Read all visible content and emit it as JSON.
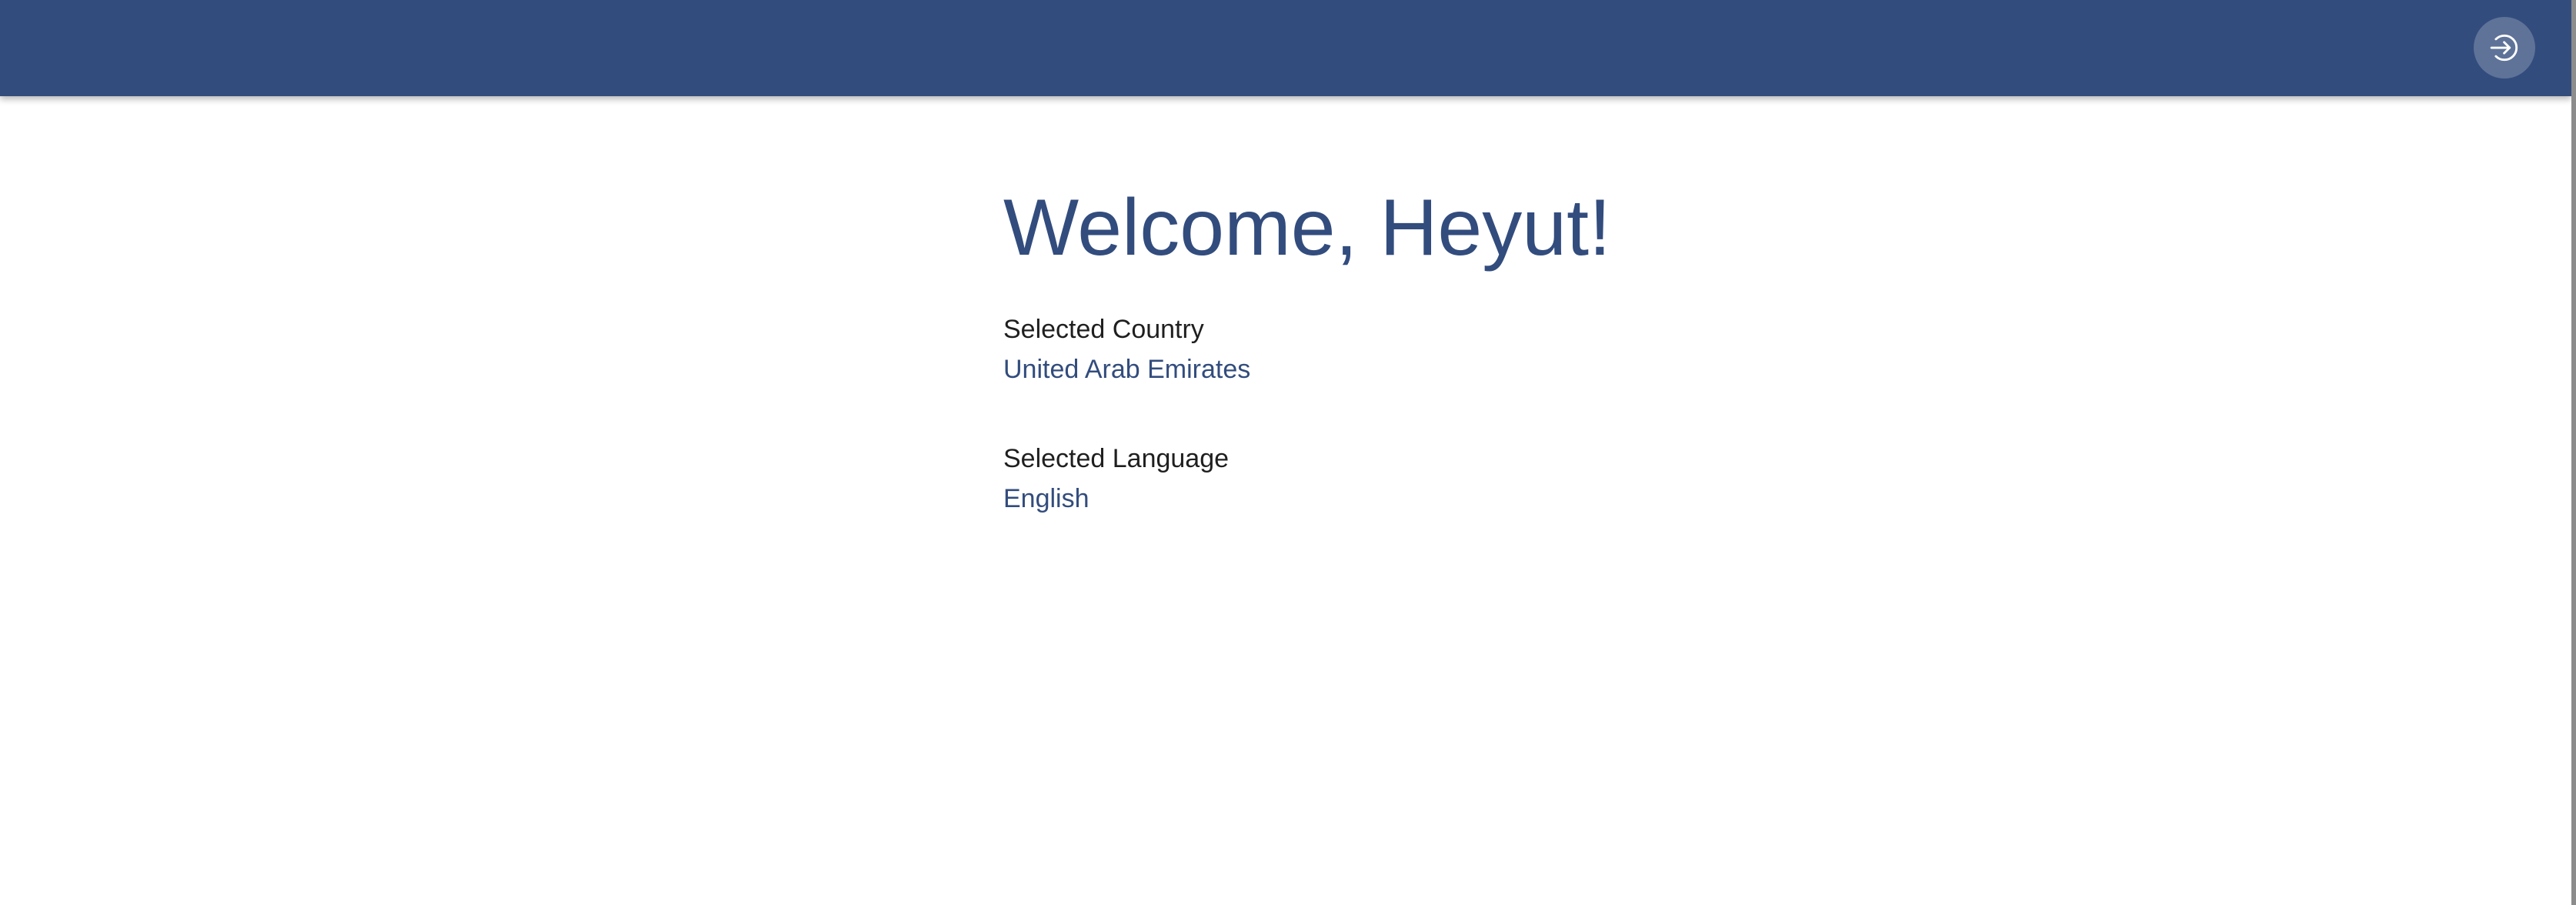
{
  "header": {
    "background_color": "#324c7d",
    "logout_icon": "sign-in-arrow-circle-icon"
  },
  "welcome": {
    "heading": "Welcome, Heyut!"
  },
  "selection": {
    "country_label": "Selected Country",
    "country_value": "United Arab Emirates",
    "language_label": "Selected Language",
    "language_value": "English"
  },
  "colors": {
    "accent": "#324c7d",
    "label_text": "#1f1f1f",
    "background": "#ffffff"
  }
}
